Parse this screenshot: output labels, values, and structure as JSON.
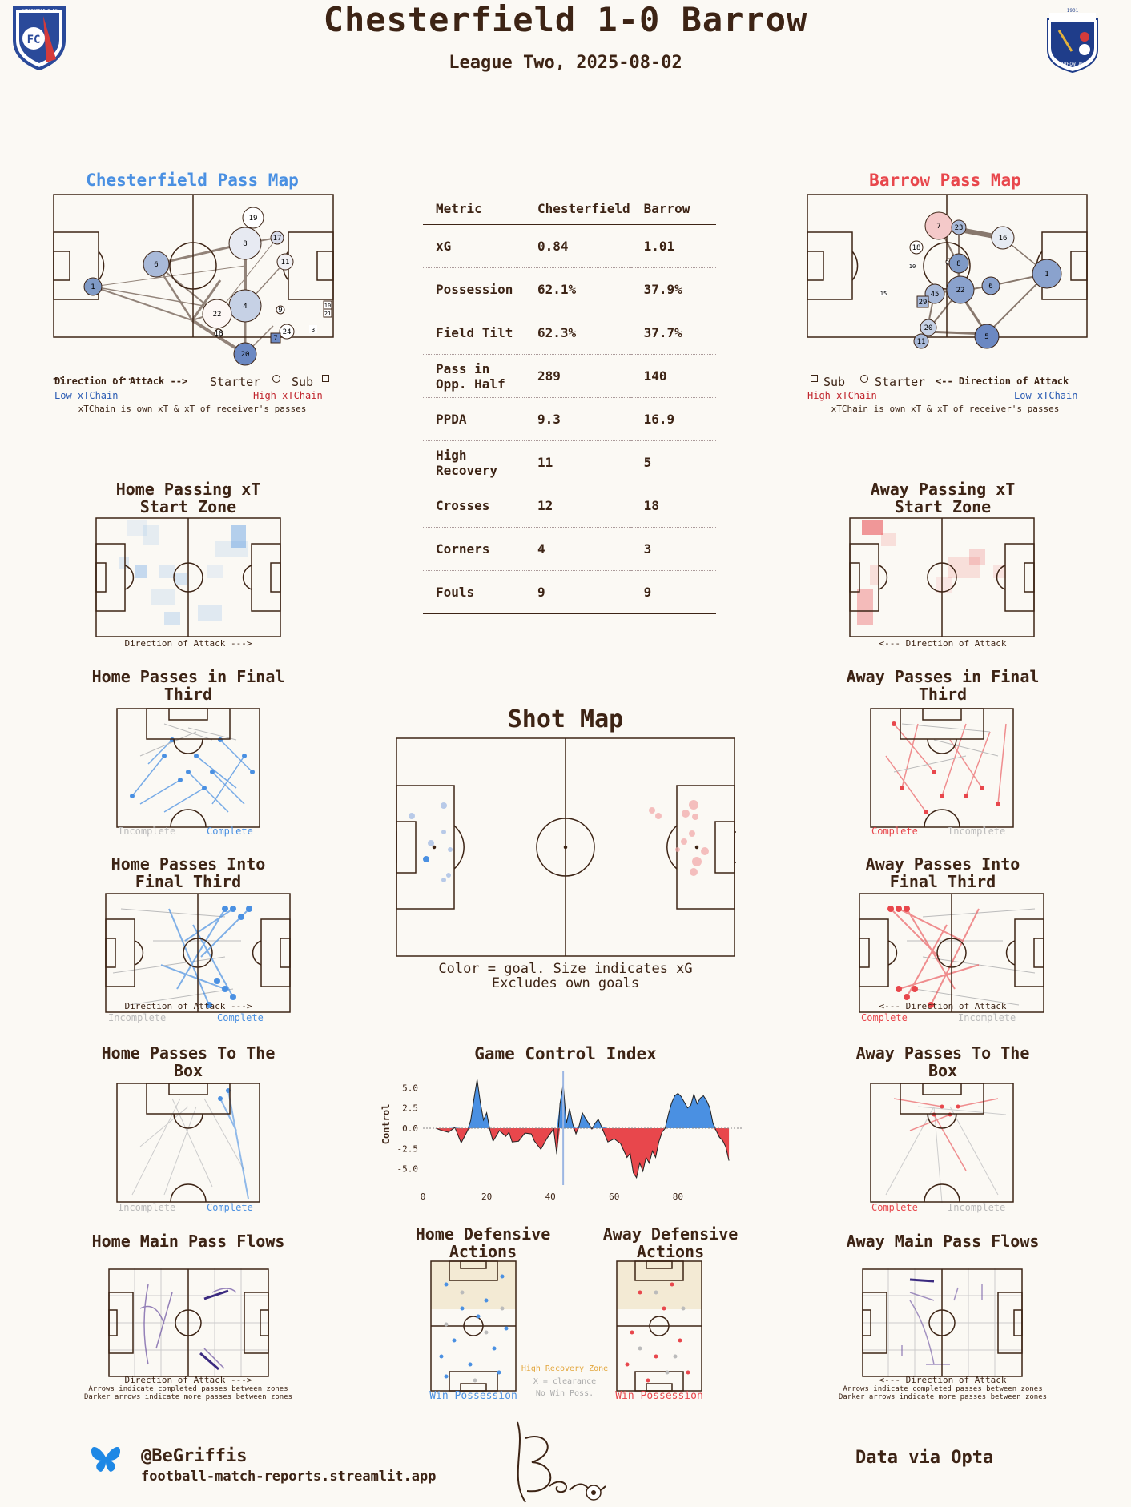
{
  "header": {
    "title": "Chesterfield 1-0 Barrow",
    "subtitle": "League Two, 2025-08-02",
    "home_badge_text": "CHESTERFIELD FC",
    "away_badge_text": "BARROW AFC",
    "away_badge_year": "1901"
  },
  "colors": {
    "home": "#4a90e2",
    "away": "#e8474c",
    "ink": "#3d2415",
    "background": "#fbf9f4",
    "hrz": "#e3a63b"
  },
  "home_pass_map": {
    "title": "Chesterfield Pass Map",
    "direction": "Direction of Attack -->",
    "starter": "Starter",
    "sub": "Sub",
    "low": "Low xTChain",
    "high": "High xTChain",
    "note": "xTChain is own xT & xT of receiver's passes",
    "players": [
      "19",
      "8",
      "17",
      "6",
      "11",
      "1",
      "22",
      "4",
      "9",
      "18",
      "24",
      "7",
      "20",
      "10",
      "21",
      "3"
    ]
  },
  "away_pass_map": {
    "title": "Barrow Pass Map",
    "direction": "<-- Direction of Attack",
    "starter": "Starter",
    "sub": "Sub",
    "low": "Low xTChain",
    "high": "High xTChain",
    "note": "xTChain is own xT & xT of receiver's passes",
    "players": [
      "7",
      "23",
      "16",
      "18",
      "10",
      "21",
      "8",
      "1",
      "45",
      "29",
      "22",
      "6",
      "15",
      "20",
      "11",
      "5"
    ]
  },
  "metrics": {
    "header": [
      "Metric",
      "Chesterfield",
      "Barrow"
    ],
    "rows": [
      {
        "label": "xG",
        "home": "0.84",
        "away": "1.01"
      },
      {
        "label": "Possession",
        "home": "62.1%",
        "away": "37.9%"
      },
      {
        "label": "Field Tilt",
        "home": "62.3%",
        "away": "37.7%"
      },
      {
        "label": "Pass in Opp. Half",
        "home": "289",
        "away": "140"
      },
      {
        "label": "PPDA",
        "home": "9.3",
        "away": "16.9"
      },
      {
        "label": "High Recovery",
        "home": "11",
        "away": "5"
      },
      {
        "label": "Crosses",
        "home": "12",
        "away": "18"
      },
      {
        "label": "Corners",
        "home": "4",
        "away": "3"
      },
      {
        "label": "Fouls",
        "home": "9",
        "away": "9"
      }
    ]
  },
  "panels": {
    "home_xt_title": "Home Passing xT Start Zone",
    "away_xt_title": "Away Passing xT Start Zone",
    "home_xt_caption": "Direction of Attack --->",
    "away_xt_caption": "<--- Direction of Attack",
    "home_final_third_title": "Home Passes in Final Third",
    "away_final_third_title": "Away Passes in Final Third",
    "home_into_final_title": "Home Passes Into Final Third",
    "away_into_final_title": "Away Passes Into Final Third",
    "home_box_title": "Home Passes To The Box",
    "away_box_title": "Away Passes To The Box",
    "home_flows_title": "Home Main Pass Flows",
    "away_flows_title": "Away Main Pass Flows",
    "incomplete": "Incomplete",
    "complete": "Complete",
    "home_dir": "Direction of Attack --->",
    "away_dir": "<--- Direction of Attack",
    "flows_note1": "Arrows indicate completed passes between zones",
    "flows_note2": "Darker arrows indicate more passes between zones"
  },
  "shot_map": {
    "title": "Shot Map",
    "note1": "Color = goal. Size indicates xG",
    "note2": "Excludes own goals"
  },
  "defensive": {
    "home_title": "Home Defensive Actions",
    "away_title": "Away Defensive Actions",
    "hrz": "High Recovery Zone",
    "clearance": "X = clearance",
    "no_win": "No Win Poss.",
    "win": "Win Possession"
  },
  "chart_data": {
    "type": "area",
    "title": "Game Control Index",
    "ylabel": "Control",
    "xlabel": "",
    "xlim": [
      0,
      100
    ],
    "ylim": [
      -7,
      7
    ],
    "xticks": [
      "0",
      "20",
      "40",
      "60",
      "80"
    ],
    "yticks": [
      "5.0",
      "2.5",
      "0.0",
      "-2.5",
      "-5.0"
    ],
    "x": [
      4,
      6,
      8,
      10,
      12,
      14,
      15,
      16,
      17,
      18,
      19,
      20,
      21,
      22,
      24,
      26,
      27,
      28,
      30,
      32,
      34,
      35,
      37,
      39,
      41,
      42,
      43,
      44,
      45,
      46,
      47,
      48,
      49,
      50,
      51,
      52,
      53,
      54,
      55,
      56,
      58,
      60,
      62,
      64,
      65,
      66,
      67,
      68,
      69,
      70,
      71,
      72,
      73,
      74,
      75,
      76,
      77,
      78,
      79,
      80,
      81,
      82,
      83,
      84,
      85,
      86,
      87,
      88,
      89,
      90,
      91,
      92,
      93,
      94,
      95,
      96
    ],
    "values": [
      0,
      -0.3,
      -0.5,
      0.1,
      -1.8,
      -0.3,
      1.0,
      3.6,
      6.0,
      3.2,
      1.0,
      1.9,
      -0.2,
      -1.6,
      -0.3,
      -1.0,
      -0.5,
      -1.7,
      -1.6,
      -0.6,
      -0.7,
      -1.6,
      -2.6,
      -1.2,
      -0.1,
      -3.2,
      3.0,
      5.4,
      0.6,
      2.4,
      0.5,
      -0.7,
      0.3,
      1.9,
      1.2,
      0.6,
      -0.1,
      0.6,
      1.1,
      0.2,
      -1.7,
      -1.3,
      -1.9,
      -3.6,
      -3.1,
      -5.5,
      -6.1,
      -4.3,
      -5.3,
      -3.6,
      -4.3,
      -2.8,
      -3.6,
      -1.7,
      -0.5,
      0,
      1.7,
      3.1,
      4.0,
      4.3,
      3.9,
      3.2,
      2.5,
      2.8,
      4.2,
      3.0,
      3.7,
      4.0,
      3.4,
      2.5,
      0.6,
      -0.3,
      -1.1,
      -1.5,
      -2.3,
      -4.0
    ]
  },
  "footer": {
    "handle": "@BeGriffis",
    "site": "football-match-reports.streamlit.app",
    "source": "Data via Opta"
  }
}
